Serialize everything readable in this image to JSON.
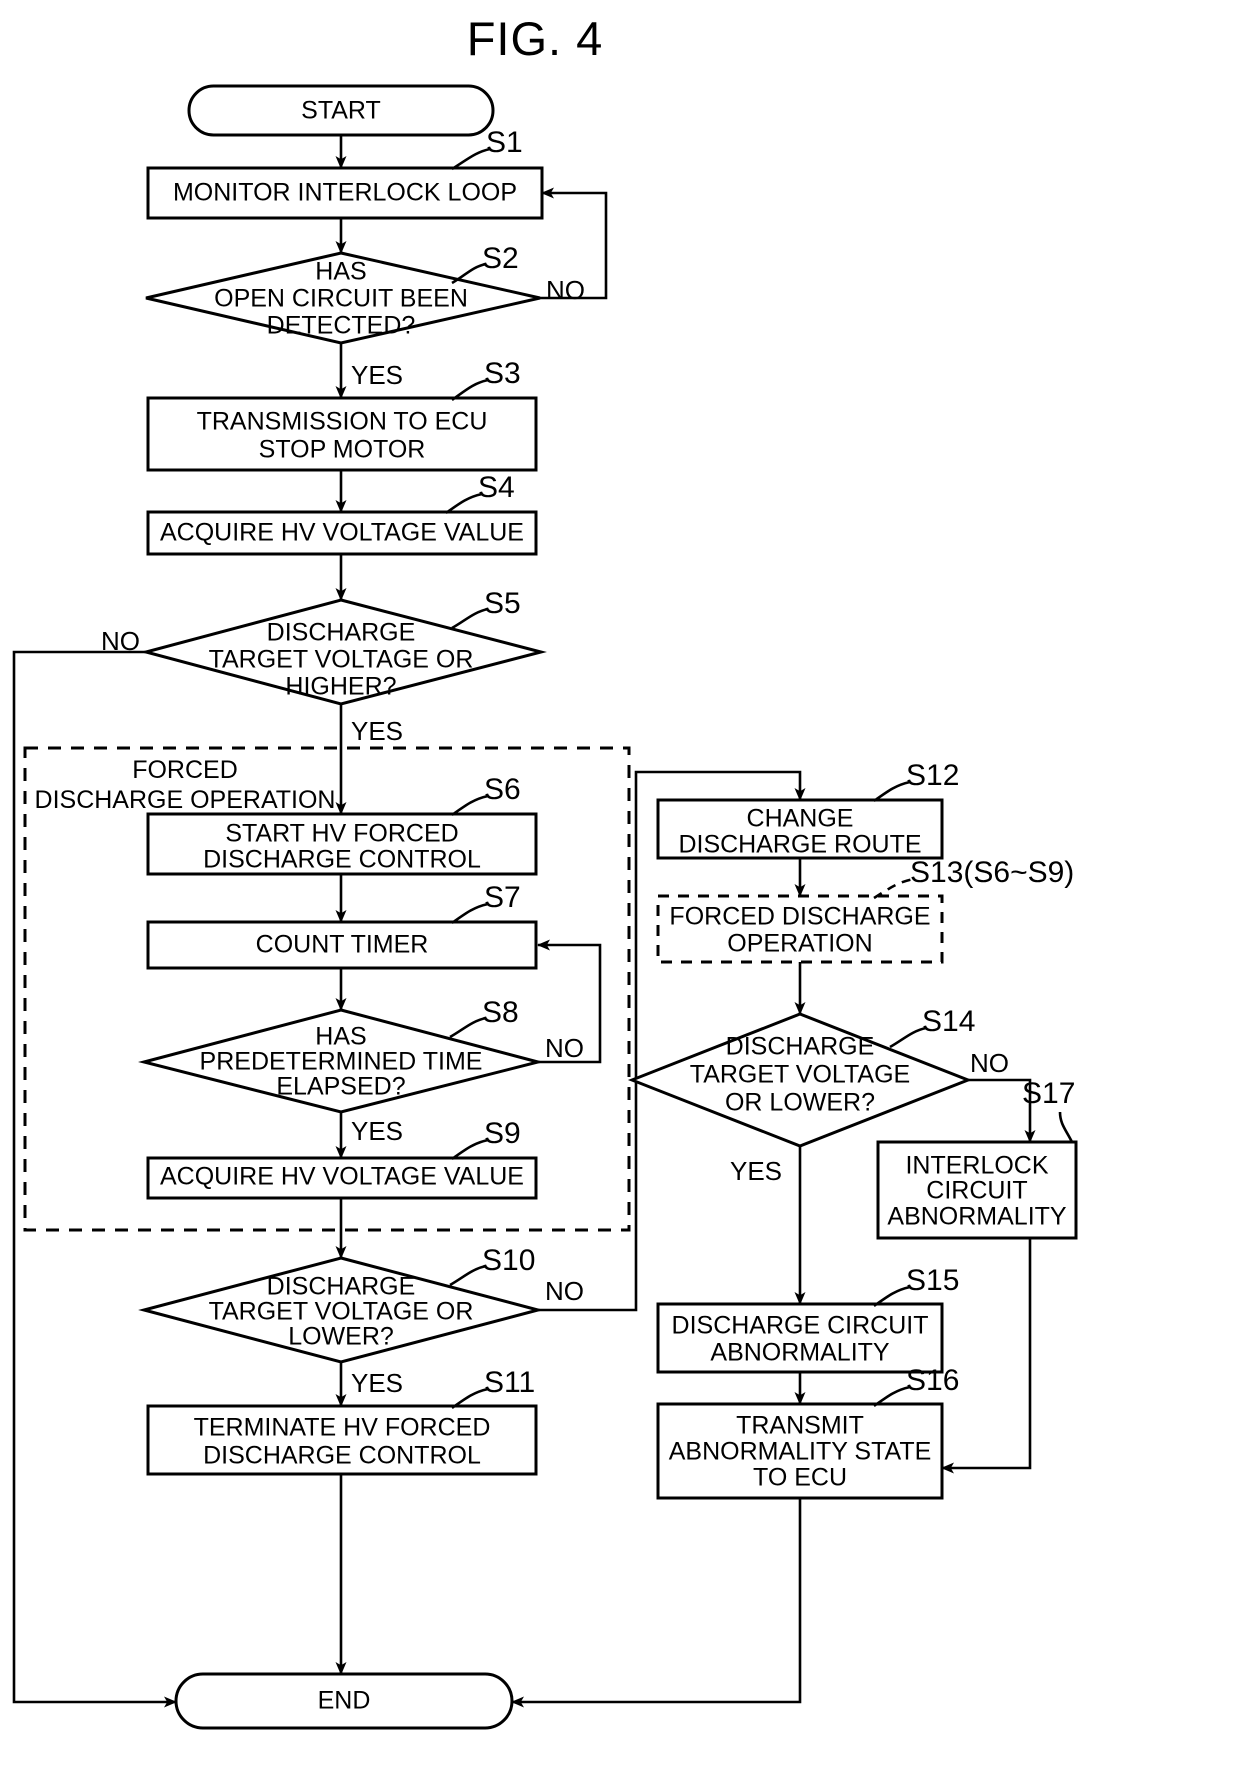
{
  "figure": {
    "title": "FIG. 4",
    "type": "flowchart"
  },
  "nodes": {
    "start": {
      "label": "START",
      "shape": "terminator"
    },
    "s1": {
      "step": "S1",
      "label": "MONITOR INTERLOCK LOOP",
      "shape": "process"
    },
    "s2": {
      "step": "S2",
      "line1": "HAS",
      "line2": "OPEN CIRCUIT BEEN",
      "line3": "DETECTED?",
      "shape": "decision"
    },
    "s3": {
      "step": "S3",
      "line1": "TRANSMISSION TO ECU",
      "line2": "STOP MOTOR",
      "shape": "process"
    },
    "s4": {
      "step": "S4",
      "label": "ACQUIRE HV VOLTAGE VALUE",
      "shape": "process"
    },
    "s5": {
      "step": "S5",
      "line1": "DISCHARGE",
      "line2": "TARGET VOLTAGE OR",
      "line3": "HIGHER?",
      "shape": "decision"
    },
    "s6": {
      "step": "S6",
      "line1": "START HV FORCED",
      "line2": "DISCHARGE CONTROL",
      "shape": "process"
    },
    "s7": {
      "step": "S7",
      "label": "COUNT TIMER",
      "shape": "process"
    },
    "s8": {
      "step": "S8",
      "line1": "HAS",
      "line2": "PREDETERMINED TIME",
      "line3": "ELAPSED?",
      "shape": "decision"
    },
    "s9": {
      "step": "S9",
      "label": "ACQUIRE HV VOLTAGE VALUE",
      "shape": "process"
    },
    "s10": {
      "step": "S10",
      "line1": "DISCHARGE",
      "line2": "TARGET VOLTAGE OR",
      "line3": "LOWER?",
      "shape": "decision"
    },
    "s11": {
      "step": "S11",
      "line1": "TERMINATE HV FORCED",
      "line2": "DISCHARGE CONTROL",
      "shape": "process"
    },
    "s12": {
      "step": "S12",
      "line1": "CHANGE",
      "line2": "DISCHARGE ROUTE",
      "shape": "process"
    },
    "s13": {
      "step": "S13(S6~S9)",
      "line1": "FORCED DISCHARGE",
      "line2": "OPERATION",
      "shape": "process-dashed"
    },
    "s14": {
      "step": "S14",
      "line1": "DISCHARGE",
      "line2": "TARGET VOLTAGE",
      "line3": "OR LOWER?",
      "shape": "decision"
    },
    "s15": {
      "step": "S15",
      "line1": "DISCHARGE CIRCUIT",
      "line2": "ABNORMALITY",
      "shape": "process"
    },
    "s16": {
      "step": "S16",
      "line1": "TRANSMIT",
      "line2": "ABNORMALITY STATE",
      "line3": "TO ECU",
      "shape": "process"
    },
    "s17": {
      "step": "S17",
      "line1": "INTERLOCK",
      "line2": "CIRCUIT",
      "line3": "ABNORMALITY",
      "shape": "process"
    },
    "end": {
      "label": "END",
      "shape": "terminator"
    }
  },
  "groups": {
    "forced_discharge": {
      "line1": "FORCED",
      "line2": "DISCHARGE OPERATION"
    }
  },
  "branches": {
    "s2_no": "NO",
    "s2_yes": "YES",
    "s5_no": "NO",
    "s5_yes": "YES",
    "s8_no": "NO",
    "s8_yes": "YES",
    "s10_no": "NO",
    "s10_yes": "YES",
    "s14_no": "NO",
    "s14_yes": "YES"
  },
  "colors": {
    "stroke": "#000000",
    "background": "#ffffff"
  }
}
